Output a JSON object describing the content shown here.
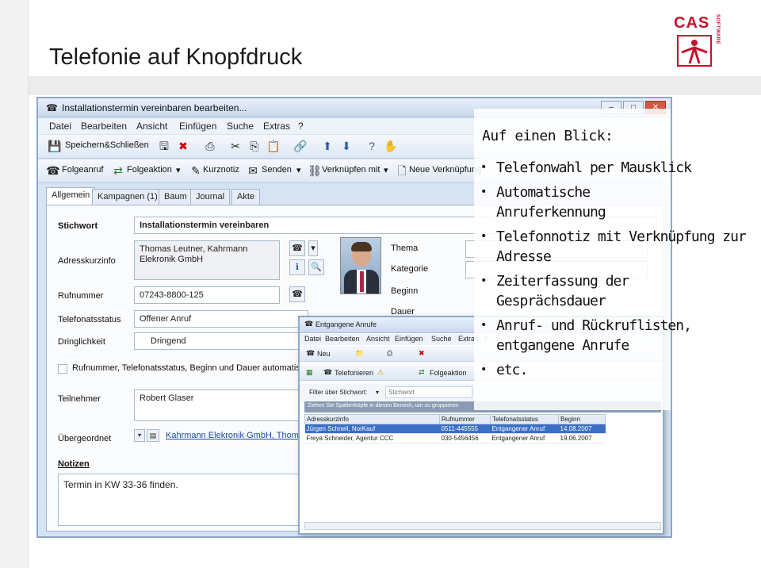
{
  "slide": {
    "title": "Telefonie auf Knopfdruck",
    "logo": "CAS",
    "logo_sub": "SOFTWARE"
  },
  "main_window": {
    "title": "Installationstermin vereinbaren bearbeiten...",
    "menu": [
      "Datei",
      "Bearbeiten",
      "Ansicht",
      "Einfügen",
      "Suche",
      "Extras",
      "?"
    ],
    "toolbar_save": "Speichern&Schließen",
    "toolbar2": {
      "folgeanruf": "Folgeanruf",
      "folgeaktion": "Folgeaktion",
      "kurznotiz": "Kurznotiz",
      "senden": "Senden",
      "verknuepfen": "Verknüpfen mit",
      "neue_verknuepfung": "Neue Verknüpfung"
    },
    "tabs": [
      "Allgemein",
      "Kampagnen (1)",
      "Baum",
      "Journal",
      "Akte"
    ],
    "form": {
      "stichwort_label": "Stichwort",
      "stichwort_value": "Installationstermin vereinbaren",
      "adresskurzinfo_label": "Adresskurzinfo",
      "adresskurzinfo_line1": "Thomas Leutner, Kahrmann",
      "adresskurzinfo_line2": "Elekronik GmbH",
      "rufnummer_label": "Rufnummer",
      "rufnummer_value": "07243-8800-125",
      "telefonatsstatus_label": "Telefonatsstatus",
      "telefonatsstatus_value": "Offener Anruf",
      "dringlichkeit_label": "Dringlichkeit",
      "dringlichkeit_value": "Dringend",
      "checkbox_label": "Rufnummer, Telefonatsstatus, Beginn und Dauer automatis",
      "teilnehmer_label": "Teilnehmer",
      "teilnehmer_value": "Robert Glaser",
      "uebergeordnet_label": "Übergeordnet",
      "uebergeordnet_value": "Kahrmann Elekronik GmbH, Thomas",
      "notizen_label": "Notizen",
      "notizen_value": "Termin in KW 33-36 finden.",
      "thema_label": "Thema",
      "kategorie_label": "Kategorie",
      "beginn_label": "Beginn",
      "dauer_label": "Dauer"
    }
  },
  "popup": {
    "title": "Entgangene Anrufe",
    "menu": [
      "Datei",
      "Bearbeiten",
      "Ansicht",
      "Einfügen",
      "Suche",
      "Extras",
      "?"
    ],
    "neu": "Neu",
    "telefonieren": "Telefonieren",
    "folgeaktion": "Folgeaktion",
    "filter_label": "Filter über Stichwort:",
    "filter_placeholder": "Stichwort",
    "group_hint": "Ziehen Sie Spaltenköpfe in diesen Bereich, um zu gruppieren",
    "columns": [
      "Adresskurzinfo",
      "Rufnummer",
      "Telefonatsstatus",
      "Beginn"
    ],
    "rows": [
      [
        "Jürgen Schnell, NorKauf",
        "0511-445555",
        "Entgangener Anruf",
        "14.08.2007"
      ],
      [
        "Freya Schneider, Agentur CCC",
        "030-5456456",
        "Entgangener Anruf",
        "19.06.2007"
      ]
    ]
  },
  "callout": {
    "title": "Auf einen Blick:",
    "bullets": [
      "Telefonwahl per Mausklick",
      "Automatische Anruferkennung",
      "Telefonnotiz mit Verknüpfung zur Adresse",
      "Zeiterfassung der Gesprächsdauer",
      "Anruf- und Rückruflisten, entgangene Anrufe",
      "etc."
    ]
  }
}
